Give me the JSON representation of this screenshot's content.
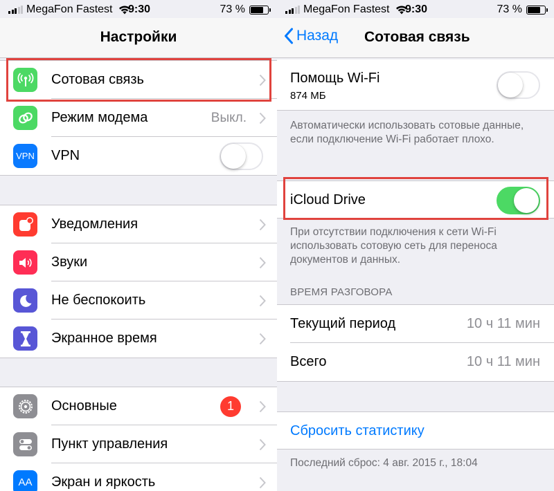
{
  "status_bar": {
    "carrier": "MegaFon Fastest",
    "time": "9:30",
    "battery_percent": "73 %",
    "battery_level": 0.73
  },
  "left": {
    "title": "Настройки",
    "group1": [
      {
        "label": "Сотовая связь",
        "icon": "cellular-antenna-icon",
        "color": "#4cd964",
        "type": "chevron"
      },
      {
        "label": "Режим модема",
        "icon": "hotspot-link-icon",
        "color": "#4cd964",
        "type": "chevron",
        "value": "Выкл."
      },
      {
        "label": "VPN",
        "icon": "vpn-icon",
        "icon_text": "VPN",
        "color": "#0a7aff",
        "type": "toggle",
        "on": false
      }
    ],
    "group2": [
      {
        "label": "Уведомления",
        "icon": "notifications-icon",
        "color": "#ff3b30"
      },
      {
        "label": "Звуки",
        "icon": "speaker-icon",
        "color": "#ff2d55"
      },
      {
        "label": "Не беспокоить",
        "icon": "moon-icon",
        "color": "#5856d6"
      },
      {
        "label": "Экранное время",
        "icon": "hourglass-icon",
        "color": "#5856d6"
      }
    ],
    "group3": [
      {
        "label": "Основные",
        "icon": "gear-icon",
        "color": "#8e8e93",
        "badge": "1"
      },
      {
        "label": "Пункт управления",
        "icon": "toggles-icon",
        "color": "#8e8e93"
      },
      {
        "label": "Экран и яркость",
        "icon": "text-size-icon",
        "icon_text": "AA",
        "color": "#007aff"
      }
    ]
  },
  "right": {
    "back_label": "Назад",
    "title": "Сотовая связь",
    "wifi_assist": {
      "label": "Помощь Wi-Fi",
      "sublabel": "874 МБ",
      "on": false
    },
    "wifi_assist_note": "Автоматически использовать сотовые данные, если подключение Wi-Fi работает плохо.",
    "icloud_drive": {
      "label": "iCloud Drive",
      "on": true
    },
    "icloud_note": "При отсутствии подключения к сети Wi-Fi использовать сотовую сеть для переноса документов и данных.",
    "call_time_header": "ВРЕМЯ РАЗГОВОРА",
    "call_time": [
      {
        "label": "Текущий период",
        "value": "10 ч 11 мин"
      },
      {
        "label": "Всего",
        "value": "10 ч 11 мин"
      }
    ],
    "reset_label": "Сбросить статистику",
    "last_reset": "Последний сброс: 4 авг. 2015 г., 18:04"
  },
  "colors": {
    "accent": "#007aff",
    "toggle_on": "#4cd964",
    "highlight": "#e0433e",
    "badge": "#ff3b30"
  }
}
